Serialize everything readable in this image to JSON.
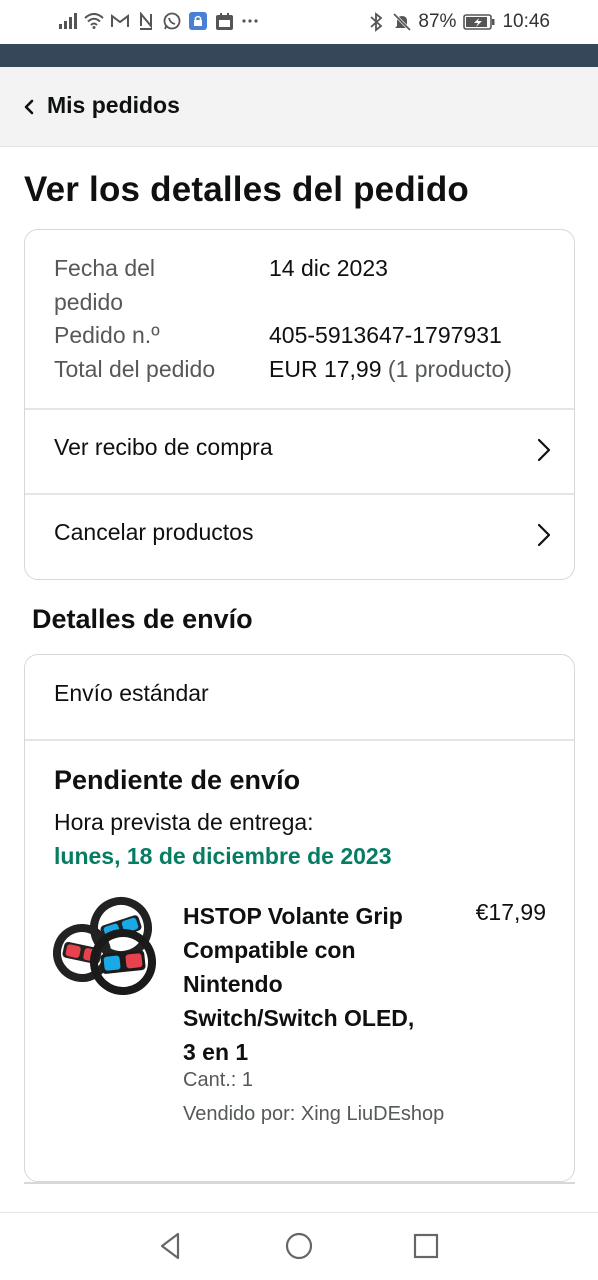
{
  "status_bar": {
    "battery": "87%",
    "time": "10:46",
    "icons_left": [
      "signal-icon",
      "wifi-icon",
      "gmail-icon",
      "n-app-icon",
      "whatsapp-icon",
      "lock-app-icon",
      "calendar-icon",
      "more-icon"
    ],
    "icons_right": [
      "bluetooth-icon",
      "mute-icon",
      "battery-icon"
    ]
  },
  "nav": {
    "back_label": "Mis pedidos"
  },
  "page": {
    "title": "Ver los detalles del pedido"
  },
  "order_info": {
    "date_label_line1": "Fecha del",
    "date_label_line2": "pedido",
    "date_value": "14 dic 2023",
    "number_label": "Pedido n.º",
    "number_value": "405-5913647-1797931",
    "total_label": "Total del pedido",
    "total_value": "EUR 17,99",
    "total_count": "(1 producto)"
  },
  "actions": {
    "receipt": "Ver recibo de compra",
    "cancel": "Cancelar productos"
  },
  "shipping": {
    "section_title": "Detalles de envío",
    "method": "Envío estándar",
    "status": "Pendiente de envío",
    "eta_label": "Hora prevista de entrega:",
    "eta_date": "lunes, 18 de diciembre de 2023"
  },
  "product": {
    "title": "HSTOP Volante Grip Compatible con Nintendo Switch/Switch OLED, 3 en 1",
    "price": "€17,99",
    "quantity": "Cant.: 1",
    "seller": "Vendido por: Xing LiuDEshop"
  },
  "colors": {
    "header_bar": "#37475a",
    "delivery_green": "#067d62",
    "joycon_red": "#e8434c",
    "joycon_blue": "#18a9e6"
  }
}
